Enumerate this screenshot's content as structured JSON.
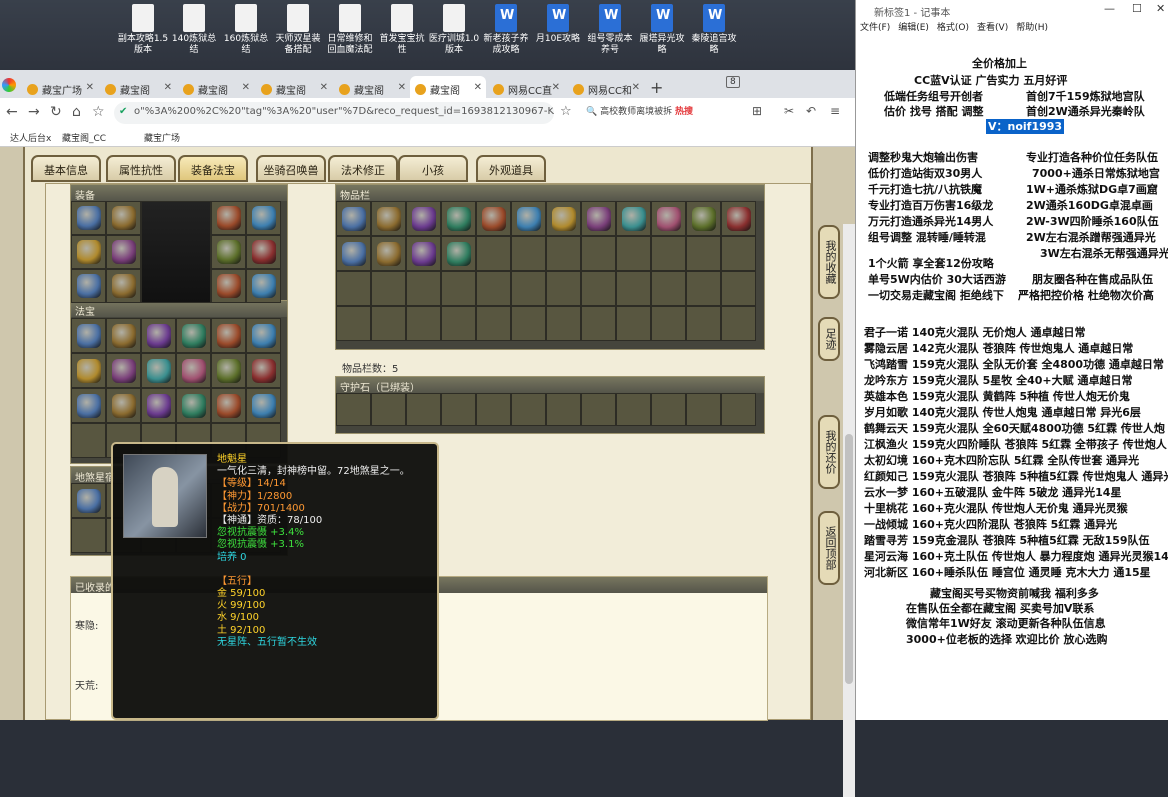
{
  "desktop": {
    "icons": [
      {
        "label": "副本攻略1.5版本",
        "type": "file"
      },
      {
        "label": "140炼狱总结",
        "type": "file"
      },
      {
        "label": "160炼狱总结",
        "type": "file"
      },
      {
        "label": "天师双星装备搭配",
        "type": "file"
      },
      {
        "label": "日常维修和回血魔法配",
        "type": "file"
      },
      {
        "label": "首发宝宝抗性",
        "type": "file"
      },
      {
        "label": "医疗训城1.0版本",
        "type": "file"
      },
      {
        "label": "新老孩子养成攻略",
        "type": "doc"
      },
      {
        "label": "月10E攻略",
        "type": "doc"
      },
      {
        "label": "组号零成本养号",
        "type": "doc"
      },
      {
        "label": "履塔异光攻略",
        "type": "doc"
      },
      {
        "label": "秦陵追宫攻略",
        "type": "doc"
      }
    ]
  },
  "browser": {
    "tabs": [
      {
        "label": "藏宝广场"
      },
      {
        "label": "藏宝阁"
      },
      {
        "label": "藏宝阁"
      },
      {
        "label": "藏宝阁"
      },
      {
        "label": "藏宝阁"
      },
      {
        "label": "藏宝阁"
      },
      {
        "label": "网易CC直"
      },
      {
        "label": "网易CC和"
      }
    ],
    "tab_counter": "8",
    "url": "o\"%3A%200%2C%20\"tag\"%3A%20\"user\"%7D&reco_request_id=1693812130967-Kgmj",
    "search_text": "高校教师离境被拆",
    "search_hot": "热搜",
    "bookmarks": [
      "达人后台x",
      "藏宝阁_CC",
      "藏宝广场"
    ]
  },
  "game": {
    "tabs": [
      "基本信息",
      "属性抗性",
      "装备法宝",
      "坐骑召唤兽",
      "法术修正",
      "小孩",
      "外观道具"
    ],
    "active_tab": "装备法宝",
    "sections": {
      "equip": "装备",
      "fabao": "法宝",
      "dishan": "地煞星宿",
      "inventory": "物品栏",
      "guard": "守护石（已绑装）",
      "collected": "已收录的"
    },
    "inventory_count": "物品栏数：5",
    "left_labels": [
      "寒隐:",
      "天荒:"
    ],
    "side_buttons": [
      "我的收藏",
      "足迹",
      "我的还价",
      "返回顶部"
    ]
  },
  "tooltip": {
    "name": "地魁星",
    "desc": "一气化三清，封神榜中留。72地煞星之一。",
    "level": "【等级】14/14",
    "shenli": "【神力】1/2800",
    "zhanli": "【战力】701/1400",
    "shentong": "【神通】资质：78/100",
    "resist1": "忽视抗震慑 +3.4%",
    "resist2": "忽视抗震慑 +3.1%",
    "peiyang": "培养 0",
    "wuxing_title": "【五行】",
    "metal": "金 59/100",
    "fire": "火 99/100",
    "water": "水 9/100",
    "earth": "土 92/100",
    "note": "无星阵、五行暂不生效"
  },
  "notepad": {
    "title": "新标签1 - 记事本",
    "menu": [
      "文件(F)",
      "编辑(E)",
      "格式(O)",
      "查看(V)",
      "帮助(H)"
    ],
    "lines": [
      "全价格加上",
      "CC蓝V认证 广告实力 五月好评",
      "低端任务组号开创者",
      "首创7千159炼狱地宫队",
      "估价 找号 搭配 调整",
      "首创2W通杀异光秦岭队",
      "V：noif1993",
      "调整秒鬼大炮输出伤害",
      "专业打造各种价位任务队伍",
      "低价打造站街双30男人",
      "7000+通杀日常炼狱地宫",
      "千元打造七抗/八抗铁魔",
      "1W+通杀炼狱DG卓7画窟",
      "专业打造百万伤害16级龙",
      "2W通杀160DG卓混卓画",
      "万元打造通杀异光14男人",
      "2W-3W四阶睡杀160队伍",
      "组号调整 混转睡/睡转混",
      "2W左右混杀蹭帮强通异光",
      "3W左右混杀无帮强通异光",
      "1个火箭 享全套12份攻略",
      "单号5W内估价 30大话西游",
      "朋友圈各种在售成品队伍",
      "一切交易走藏宝阁 拒绝线下",
      "严格把控价格 杜绝物次价高",
      "君子一诺 140克火混队 无价炮人 通卓越日常",
      "雾隐云居 142克火混队 苍狼阵 传世炮鬼人 通卓越日常",
      "飞鸿踏雪 159克火混队 全队无价套 全4800功德 通卓越日常",
      "龙吟东方 159克火混队 5星牧 全40+大赋 通卓越日常",
      "英雄本色 159克火混队 黄鹤阵 5种植 传世人炮无价鬼",
      "岁月如歌 140克火混队 传世人炮鬼 通卓越日常 异光6层",
      "鹤舞云天 159克火混队 全60天赋4800功德 5红霖 传世人炮",
      "江枫渔火 159克火四阶睡队 苍狼阵 5红霖 全带孩子 传世炮人",
      "太初幻境 160+克木四阶忘队 5红霖 全队传世套 通异光",
      "红颜知己 159克火混队 苍狼阵 5种植5红霖 传世炮鬼人 通异光",
      "云水一梦 160+五破混队 金牛阵 5破龙 通异光14星",
      "十里桃花 160+克火混队 传世炮人无价鬼 通异光灵猴",
      "一战倾城 160+克火四阶混队 苍狼阵 5红霖 通异光",
      "踏雪寻芳 159克金混队 苍狼阵 5种植5红霖 无敌159队伍",
      "星河云海 160+克土队伍 传世炮人 暴力程度炮 通异光灵猴14",
      "河北新区 160+睡杀队伍 睡宫位 通灵睡 克木大力 通15星",
      "藏宝阁买号买物资前喊我 福利多多",
      "在售队伍全都在藏宝阁 买卖号加V联系",
      "微信常年1W好友 滚动更新各种队伍信息",
      "3000+位老板的选择 欢迎比价 放心选购"
    ]
  },
  "colors": {
    "panel": "#ede7cf",
    "slot": "#585640",
    "tooltip_bg": "#0f0f0c",
    "highlight": "#0a63c9"
  }
}
